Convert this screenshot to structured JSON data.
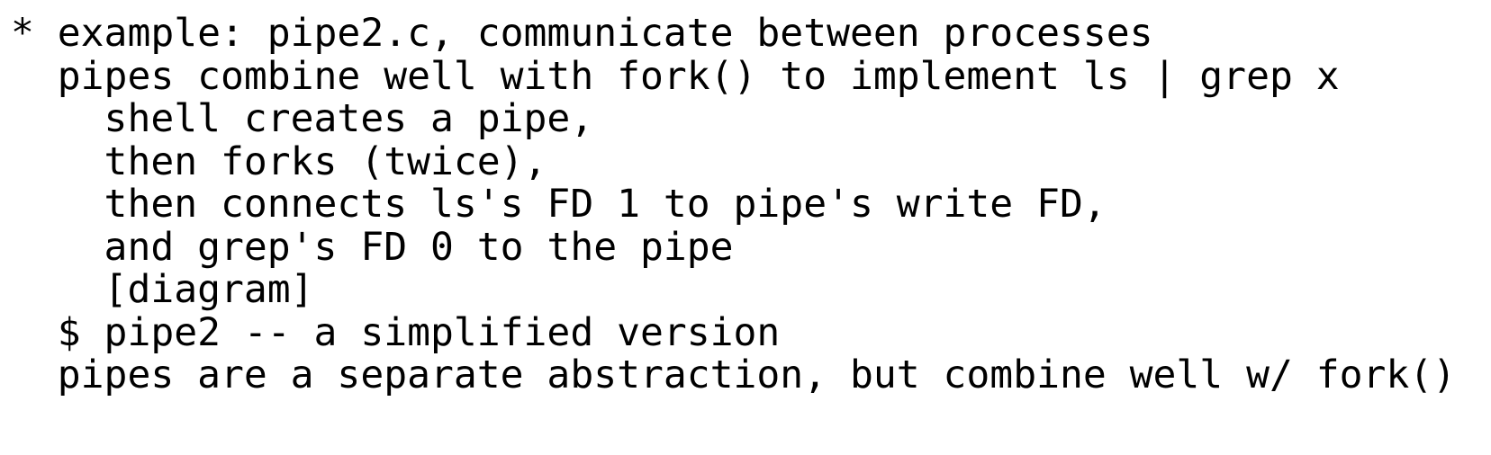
{
  "document": {
    "kind": "plain-text-notes",
    "background_color": "#ffffff",
    "text_color": "#000000",
    "font_style": "monospace",
    "lines": [
      "* example: pipe2.c, communicate between processes",
      "  pipes combine well with fork() to implement ls | grep x",
      "    shell creates a pipe,",
      "    then forks (twice),",
      "    then connects ls's FD 1 to pipe's write FD,",
      "    and grep's FD 0 to the pipe",
      "    [diagram]",
      "  $ pipe2 -- a simplified version",
      "  pipes are a separate abstraction, but combine well w/ fork()"
    ]
  }
}
